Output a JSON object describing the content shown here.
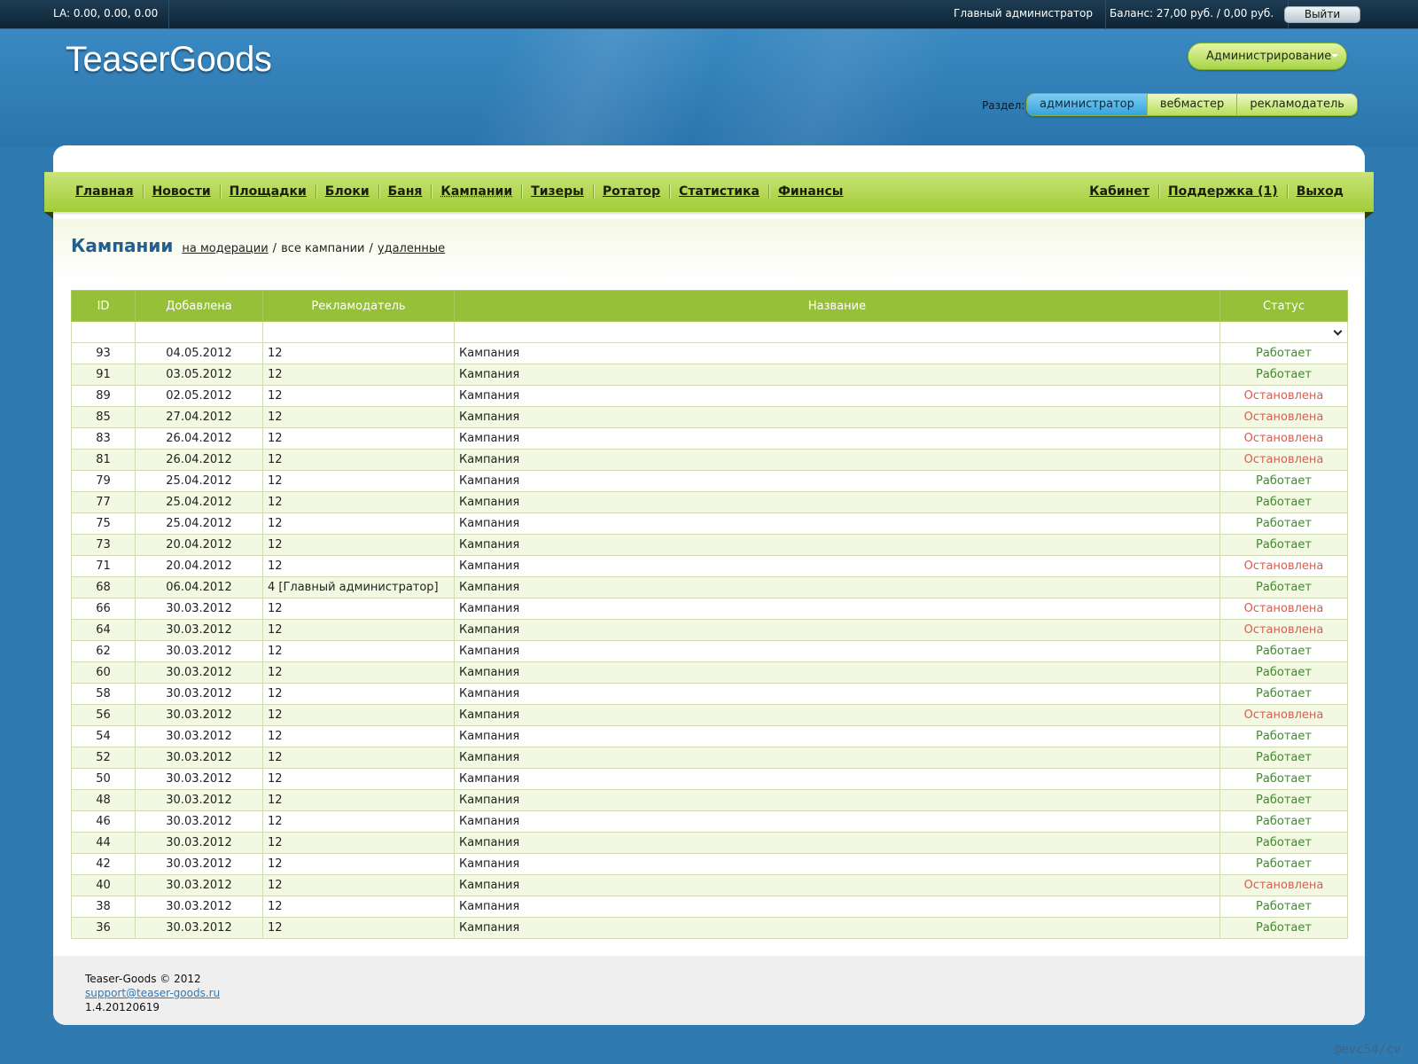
{
  "topbar": {
    "la": "LA: 0.00, 0.00, 0.00",
    "user": "Главный администратор",
    "balance": "Баланс: 27,00 руб. / 0,00 руб.",
    "logout": "Выйти"
  },
  "header": {
    "logo": "TeaserGoods",
    "admin_menu": "Администрирование",
    "section_label": "Раздел:",
    "sections": [
      "администратор",
      "вебмастер",
      "рекламодатель"
    ],
    "active_section": "администратор"
  },
  "nav": {
    "left": [
      "Главная",
      "Новости",
      "Площадки",
      "Блоки",
      "Баня",
      "Кампании",
      "Тизеры",
      "Ротатор",
      "Статистика",
      "Финансы"
    ],
    "right": [
      "Кабинет",
      "Поддержка (1)",
      "Выход"
    ]
  },
  "page": {
    "title": "Кампании",
    "crumb_moderation": "на модерации",
    "crumb_all": "все кампании",
    "crumb_deleted": "удаленные",
    "crumb_sep": "/"
  },
  "table": {
    "columns": [
      "ID",
      "Добавлена",
      "Рекламодатель",
      "Название",
      "Статус"
    ],
    "status_colors": {
      "Работает": "#3c8b2b",
      "Остановлена": "#e05a4e"
    },
    "rows": [
      {
        "id": "93",
        "date": "04.05.2012",
        "advertiser": "12",
        "name": "Кампания",
        "status": "Работает"
      },
      {
        "id": "91",
        "date": "03.05.2012",
        "advertiser": "12",
        "name": "Кампания",
        "status": "Работает"
      },
      {
        "id": "89",
        "date": "02.05.2012",
        "advertiser": "12",
        "name": "Кампания",
        "status": "Остановлена"
      },
      {
        "id": "85",
        "date": "27.04.2012",
        "advertiser": "12",
        "name": "Кампания",
        "status": "Остановлена"
      },
      {
        "id": "83",
        "date": "26.04.2012",
        "advertiser": "12",
        "name": "Кампания",
        "status": "Остановлена"
      },
      {
        "id": "81",
        "date": "26.04.2012",
        "advertiser": "12",
        "name": "Кампания",
        "status": "Остановлена"
      },
      {
        "id": "79",
        "date": "25.04.2012",
        "advertiser": "12",
        "name": "Кампания",
        "status": "Работает"
      },
      {
        "id": "77",
        "date": "25.04.2012",
        "advertiser": "12",
        "name": "Кампания",
        "status": "Работает"
      },
      {
        "id": "75",
        "date": "25.04.2012",
        "advertiser": "12",
        "name": "Кампания",
        "status": "Работает"
      },
      {
        "id": "73",
        "date": "20.04.2012",
        "advertiser": "12",
        "name": "Кампания",
        "status": "Работает"
      },
      {
        "id": "71",
        "date": "20.04.2012",
        "advertiser": "12",
        "name": "Кампания",
        "status": "Остановлена"
      },
      {
        "id": "68",
        "date": "06.04.2012",
        "advertiser": "4 [Главный администратор]",
        "name": "Кампания",
        "status": "Работает"
      },
      {
        "id": "66",
        "date": "30.03.2012",
        "advertiser": "12",
        "name": "Кампания",
        "status": "Остановлена"
      },
      {
        "id": "64",
        "date": "30.03.2012",
        "advertiser": "12",
        "name": "Кампания",
        "status": "Остановлена"
      },
      {
        "id": "62",
        "date": "30.03.2012",
        "advertiser": "12",
        "name": "Кампания",
        "status": "Работает"
      },
      {
        "id": "60",
        "date": "30.03.2012",
        "advertiser": "12",
        "name": "Кампания",
        "status": "Работает"
      },
      {
        "id": "58",
        "date": "30.03.2012",
        "advertiser": "12",
        "name": "Кампания",
        "status": "Работает"
      },
      {
        "id": "56",
        "date": "30.03.2012",
        "advertiser": "12",
        "name": "Кампания",
        "status": "Остановлена"
      },
      {
        "id": "54",
        "date": "30.03.2012",
        "advertiser": "12",
        "name": "Кампания",
        "status": "Работает"
      },
      {
        "id": "52",
        "date": "30.03.2012",
        "advertiser": "12",
        "name": "Кампания",
        "status": "Работает"
      },
      {
        "id": "50",
        "date": "30.03.2012",
        "advertiser": "12",
        "name": "Кампания",
        "status": "Работает"
      },
      {
        "id": "48",
        "date": "30.03.2012",
        "advertiser": "12",
        "name": "Кампания",
        "status": "Работает"
      },
      {
        "id": "46",
        "date": "30.03.2012",
        "advertiser": "12",
        "name": "Кампания",
        "status": "Работает"
      },
      {
        "id": "44",
        "date": "30.03.2012",
        "advertiser": "12",
        "name": "Кампания",
        "status": "Работает"
      },
      {
        "id": "42",
        "date": "30.03.2012",
        "advertiser": "12",
        "name": "Кампания",
        "status": "Работает"
      },
      {
        "id": "40",
        "date": "30.03.2012",
        "advertiser": "12",
        "name": "Кампания",
        "status": "Остановлена"
      },
      {
        "id": "38",
        "date": "30.03.2012",
        "advertiser": "12",
        "name": "Кампания",
        "status": "Работает"
      },
      {
        "id": "36",
        "date": "30.03.2012",
        "advertiser": "12",
        "name": "Кампания",
        "status": "Работает"
      }
    ]
  },
  "footer": {
    "copyright": "Teaser-Goods © 2012",
    "email": "support@teaser-goods.ru",
    "version": "1.4.20120619"
  },
  "watermark": "@evc54/cv"
}
